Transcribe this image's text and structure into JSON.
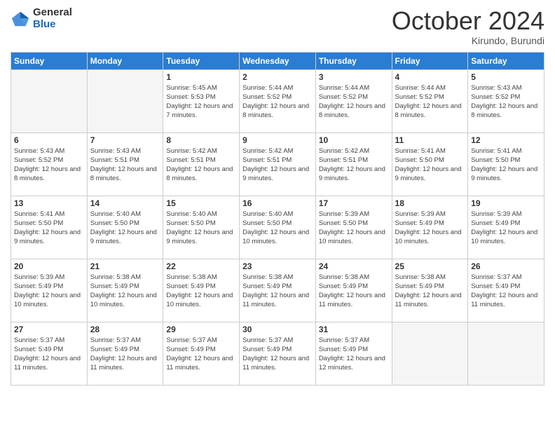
{
  "logo": {
    "general": "General",
    "blue": "Blue"
  },
  "header": {
    "month": "October 2024",
    "location": "Kirundo, Burundi"
  },
  "weekdays": [
    "Sunday",
    "Monday",
    "Tuesday",
    "Wednesday",
    "Thursday",
    "Friday",
    "Saturday"
  ],
  "weeks": [
    [
      {
        "day": "",
        "sunrise": "",
        "sunset": "",
        "daylight": ""
      },
      {
        "day": "",
        "sunrise": "",
        "sunset": "",
        "daylight": ""
      },
      {
        "day": "1",
        "sunrise": "Sunrise: 5:45 AM",
        "sunset": "Sunset: 5:53 PM",
        "daylight": "Daylight: 12 hours and 7 minutes."
      },
      {
        "day": "2",
        "sunrise": "Sunrise: 5:44 AM",
        "sunset": "Sunset: 5:52 PM",
        "daylight": "Daylight: 12 hours and 8 minutes."
      },
      {
        "day": "3",
        "sunrise": "Sunrise: 5:44 AM",
        "sunset": "Sunset: 5:52 PM",
        "daylight": "Daylight: 12 hours and 8 minutes."
      },
      {
        "day": "4",
        "sunrise": "Sunrise: 5:44 AM",
        "sunset": "Sunset: 5:52 PM",
        "daylight": "Daylight: 12 hours and 8 minutes."
      },
      {
        "day": "5",
        "sunrise": "Sunrise: 5:43 AM",
        "sunset": "Sunset: 5:52 PM",
        "daylight": "Daylight: 12 hours and 8 minutes."
      }
    ],
    [
      {
        "day": "6",
        "sunrise": "Sunrise: 5:43 AM",
        "sunset": "Sunset: 5:52 PM",
        "daylight": "Daylight: 12 hours and 8 minutes."
      },
      {
        "day": "7",
        "sunrise": "Sunrise: 5:43 AM",
        "sunset": "Sunset: 5:51 PM",
        "daylight": "Daylight: 12 hours and 8 minutes."
      },
      {
        "day": "8",
        "sunrise": "Sunrise: 5:42 AM",
        "sunset": "Sunset: 5:51 PM",
        "daylight": "Daylight: 12 hours and 8 minutes."
      },
      {
        "day": "9",
        "sunrise": "Sunrise: 5:42 AM",
        "sunset": "Sunset: 5:51 PM",
        "daylight": "Daylight: 12 hours and 9 minutes."
      },
      {
        "day": "10",
        "sunrise": "Sunrise: 5:42 AM",
        "sunset": "Sunset: 5:51 PM",
        "daylight": "Daylight: 12 hours and 9 minutes."
      },
      {
        "day": "11",
        "sunrise": "Sunrise: 5:41 AM",
        "sunset": "Sunset: 5:50 PM",
        "daylight": "Daylight: 12 hours and 9 minutes."
      },
      {
        "day": "12",
        "sunrise": "Sunrise: 5:41 AM",
        "sunset": "Sunset: 5:50 PM",
        "daylight": "Daylight: 12 hours and 9 minutes."
      }
    ],
    [
      {
        "day": "13",
        "sunrise": "Sunrise: 5:41 AM",
        "sunset": "Sunset: 5:50 PM",
        "daylight": "Daylight: 12 hours and 9 minutes."
      },
      {
        "day": "14",
        "sunrise": "Sunrise: 5:40 AM",
        "sunset": "Sunset: 5:50 PM",
        "daylight": "Daylight: 12 hours and 9 minutes."
      },
      {
        "day": "15",
        "sunrise": "Sunrise: 5:40 AM",
        "sunset": "Sunset: 5:50 PM",
        "daylight": "Daylight: 12 hours and 9 minutes."
      },
      {
        "day": "16",
        "sunrise": "Sunrise: 5:40 AM",
        "sunset": "Sunset: 5:50 PM",
        "daylight": "Daylight: 12 hours and 10 minutes."
      },
      {
        "day": "17",
        "sunrise": "Sunrise: 5:39 AM",
        "sunset": "Sunset: 5:50 PM",
        "daylight": "Daylight: 12 hours and 10 minutes."
      },
      {
        "day": "18",
        "sunrise": "Sunrise: 5:39 AM",
        "sunset": "Sunset: 5:49 PM",
        "daylight": "Daylight: 12 hours and 10 minutes."
      },
      {
        "day": "19",
        "sunrise": "Sunrise: 5:39 AM",
        "sunset": "Sunset: 5:49 PM",
        "daylight": "Daylight: 12 hours and 10 minutes."
      }
    ],
    [
      {
        "day": "20",
        "sunrise": "Sunrise: 5:39 AM",
        "sunset": "Sunset: 5:49 PM",
        "daylight": "Daylight: 12 hours and 10 minutes."
      },
      {
        "day": "21",
        "sunrise": "Sunrise: 5:38 AM",
        "sunset": "Sunset: 5:49 PM",
        "daylight": "Daylight: 12 hours and 10 minutes."
      },
      {
        "day": "22",
        "sunrise": "Sunrise: 5:38 AM",
        "sunset": "Sunset: 5:49 PM",
        "daylight": "Daylight: 12 hours and 10 minutes."
      },
      {
        "day": "23",
        "sunrise": "Sunrise: 5:38 AM",
        "sunset": "Sunset: 5:49 PM",
        "daylight": "Daylight: 12 hours and 11 minutes."
      },
      {
        "day": "24",
        "sunrise": "Sunrise: 5:38 AM",
        "sunset": "Sunset: 5:49 PM",
        "daylight": "Daylight: 12 hours and 11 minutes."
      },
      {
        "day": "25",
        "sunrise": "Sunrise: 5:38 AM",
        "sunset": "Sunset: 5:49 PM",
        "daylight": "Daylight: 12 hours and 11 minutes."
      },
      {
        "day": "26",
        "sunrise": "Sunrise: 5:37 AM",
        "sunset": "Sunset: 5:49 PM",
        "daylight": "Daylight: 12 hours and 11 minutes."
      }
    ],
    [
      {
        "day": "27",
        "sunrise": "Sunrise: 5:37 AM",
        "sunset": "Sunset: 5:49 PM",
        "daylight": "Daylight: 12 hours and 11 minutes."
      },
      {
        "day": "28",
        "sunrise": "Sunrise: 5:37 AM",
        "sunset": "Sunset: 5:49 PM",
        "daylight": "Daylight: 12 hours and 11 minutes."
      },
      {
        "day": "29",
        "sunrise": "Sunrise: 5:37 AM",
        "sunset": "Sunset: 5:49 PM",
        "daylight": "Daylight: 12 hours and 11 minutes."
      },
      {
        "day": "30",
        "sunrise": "Sunrise: 5:37 AM",
        "sunset": "Sunset: 5:49 PM",
        "daylight": "Daylight: 12 hours and 11 minutes."
      },
      {
        "day": "31",
        "sunrise": "Sunrise: 5:37 AM",
        "sunset": "Sunset: 5:49 PM",
        "daylight": "Daylight: 12 hours and 12 minutes."
      },
      {
        "day": "",
        "sunrise": "",
        "sunset": "",
        "daylight": ""
      },
      {
        "day": "",
        "sunrise": "",
        "sunset": "",
        "daylight": ""
      }
    ]
  ]
}
